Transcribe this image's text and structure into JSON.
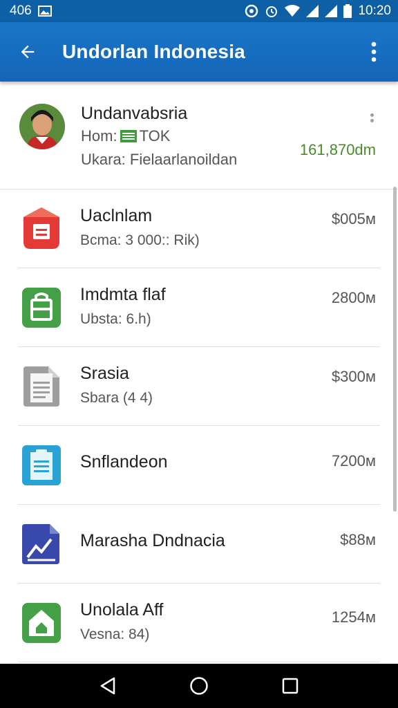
{
  "status_bar": {
    "left_text": "406",
    "time": "10:20"
  },
  "app_bar": {
    "title": "Undorlan Indonesia",
    "back_icon": "arrow-back-icon",
    "menu_icon": "more-vert-icon"
  },
  "header": {
    "name": "Undanvabsria",
    "line2_prefix": "Hom:",
    "line2_suffix": "TOK",
    "line3": "Ukara: Fielaarlanoildan",
    "amount": "161,870dm"
  },
  "items": [
    {
      "title": "Uaclnlam",
      "subtitle": "Bcma: 3 000:: Rik)",
      "amount": "$005м",
      "icon": "red-app-icon",
      "color": "#e53935"
    },
    {
      "title": "Imdmta flaf",
      "subtitle": "Ubsta: 6.h)",
      "amount": "2800м",
      "icon": "green-bag-icon",
      "color": "#43a047"
    },
    {
      "title": "Srasia",
      "subtitle": "Sbara (4 4)",
      "amount": "$300м",
      "icon": "grey-document-icon",
      "color": "#9e9e9e"
    },
    {
      "title": "Snflandeon",
      "subtitle": "",
      "amount": "7200м",
      "icon": "blue-clipboard-icon",
      "color": "#29a3d6"
    },
    {
      "title": "Marasha Dndnacia",
      "subtitle": "",
      "amount": "$88м",
      "icon": "indigo-chart-icon",
      "color": "#3949ab"
    },
    {
      "title": "Unolala Aff",
      "subtitle": "Vesna: 84)",
      "amount": "1254м",
      "icon": "green-home-icon",
      "color": "#43a047"
    }
  ],
  "colors": {
    "status_bar": "#0d5fa6",
    "app_bar": "#1976c8",
    "amount_positive": "#4b8a2b"
  }
}
